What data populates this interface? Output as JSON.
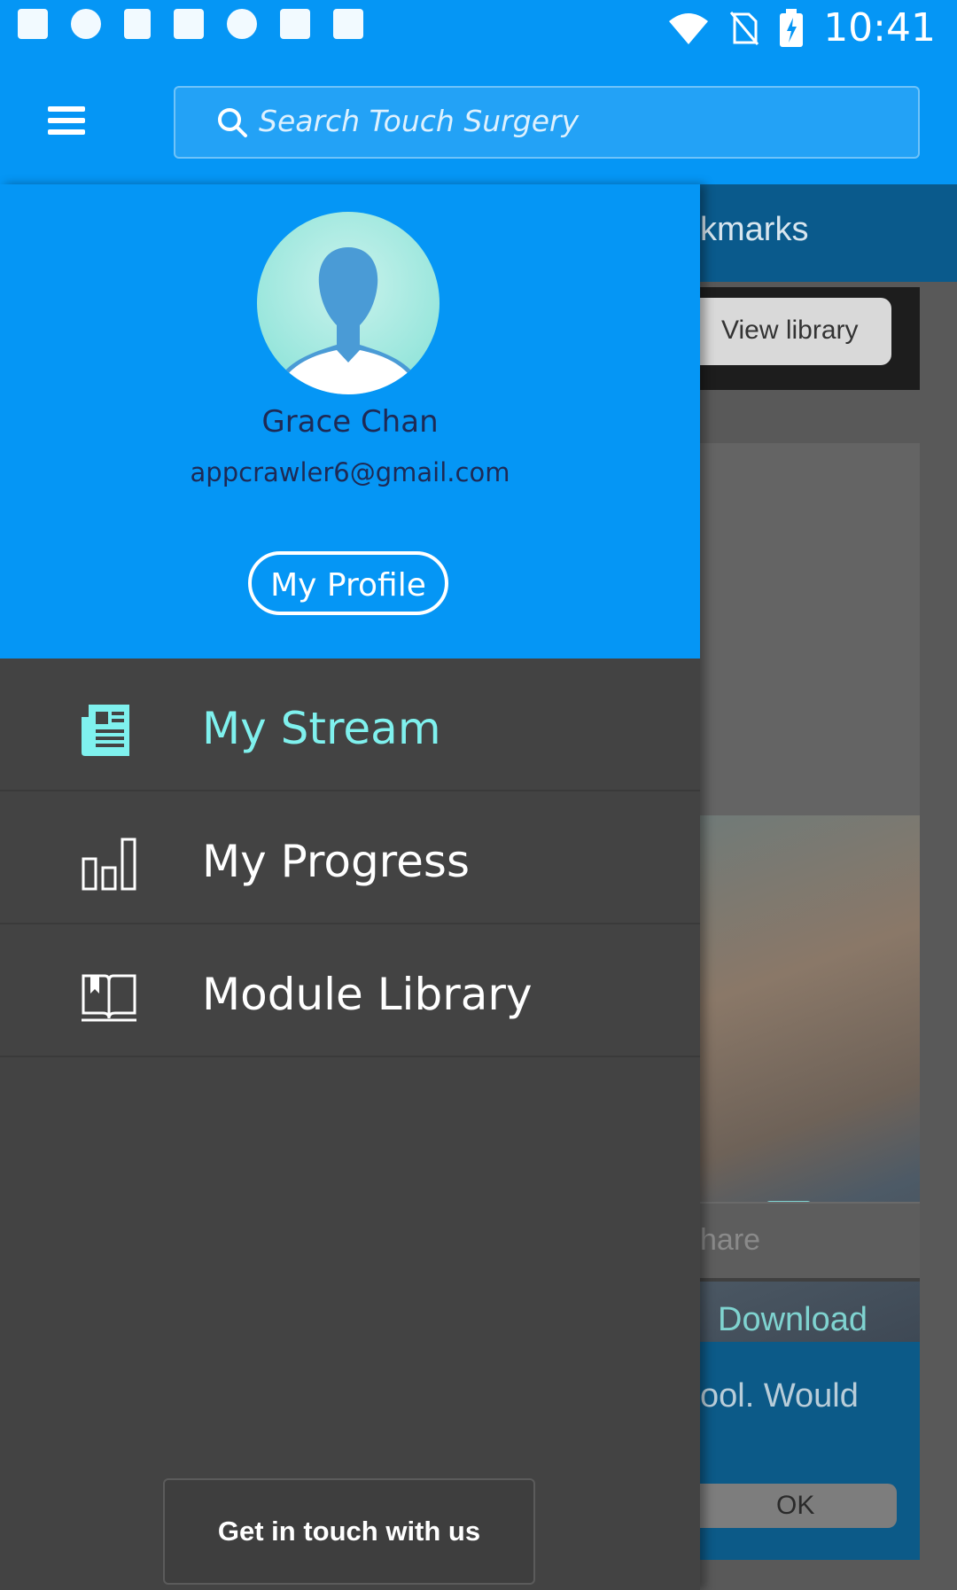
{
  "statusbar": {
    "time": "10:41",
    "icons": [
      "notification-icon",
      "sync-icon",
      "signal-icon",
      "camera-icon",
      "cloud-icon",
      "photo-icon",
      "bag-icon",
      "wifi-icon",
      "no-sim-icon",
      "battery-icon"
    ]
  },
  "appbar": {
    "menu_icon": "hamburger-menu-icon",
    "search_placeholder": "Search Touch Surgery"
  },
  "background_page": {
    "tab_label": "kmarks",
    "view_library_label": "View library",
    "download_label": "Download",
    "share_label": "hare",
    "card_text": "ool. Would",
    "ok_label": "OK"
  },
  "drawer": {
    "user": {
      "name": "Grace Chan",
      "email": "appcrawler6@gmail.com"
    },
    "profile_button": "My Profile",
    "menu": [
      {
        "label": "My Stream",
        "icon": "news-feed-icon",
        "active": true
      },
      {
        "label": "My Progress",
        "icon": "bar-chart-icon",
        "active": false
      },
      {
        "label": "Module Library",
        "icon": "open-book-icon",
        "active": false
      }
    ],
    "contact_button": "Get in touch with us"
  },
  "colors": {
    "primary": "#0596f5",
    "drawer_bg": "#434343",
    "active_item": "#7ff1ee",
    "user_text": "#1e2a55"
  }
}
